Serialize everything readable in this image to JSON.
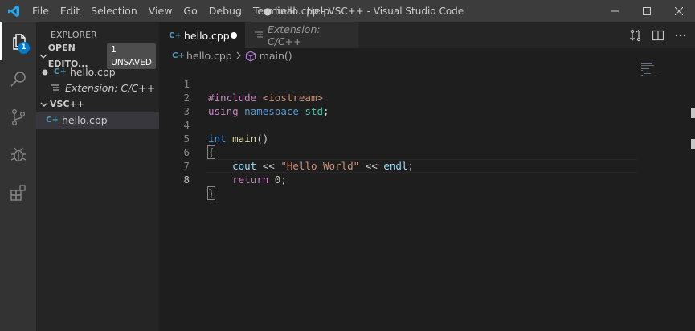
{
  "window": {
    "title": "● hello.cpp - VSC++ - Visual Studio Code",
    "app_icon": "vscode-logo-icon",
    "controls": [
      "minimize-icon",
      "maximize-icon",
      "close-icon"
    ]
  },
  "menu": {
    "items": [
      "File",
      "Edit",
      "Selection",
      "View",
      "Go",
      "Debug",
      "Terminal",
      "Help"
    ]
  },
  "activity_bar": {
    "explorer_badge": "1",
    "icons": [
      "files-icon",
      "search-icon",
      "source-control-icon",
      "debug-icon",
      "extensions-icon"
    ]
  },
  "sidebar": {
    "title": "EXPLORER",
    "open_editors": {
      "label": "OPEN EDITO...",
      "badge": "1 UNSAVED",
      "items": [
        {
          "label": "hello.cpp",
          "modified": true
        },
        {
          "label": "Extension: C/C++"
        }
      ]
    },
    "workspace": {
      "label": "VSC++",
      "items": [
        {
          "label": "hello.cpp"
        }
      ]
    }
  },
  "tabs": [
    {
      "label": "hello.cpp",
      "active": true,
      "modified": true
    },
    {
      "label": "Extension: C/C++",
      "active": false
    }
  ],
  "breadcrumb": {
    "file": "hello.cpp",
    "symbol": "main()"
  },
  "editor": {
    "line_numbers": [
      "1",
      "2",
      "3",
      "4",
      "5",
      "6",
      "7",
      "8"
    ],
    "tokens": {
      "include": "#include",
      "iostream": "<iostream>",
      "using": "using",
      "namespace": "namespace",
      "std": "std",
      "semicolon": ";",
      "int": "int",
      "main": "main",
      "parens": "()",
      "open_brace": "{",
      "cout": "cout",
      "shift": "<<",
      "hello": "\"Hello World\"",
      "endl": "endl",
      "return": "return",
      "zero": "0",
      "close_brace": "}"
    }
  },
  "colors": {
    "accent": "#007acc",
    "title_bar": "#3c3c3c",
    "activity_bar": "#333333",
    "sidebar": "#252526",
    "editor": "#1e1e1e"
  }
}
